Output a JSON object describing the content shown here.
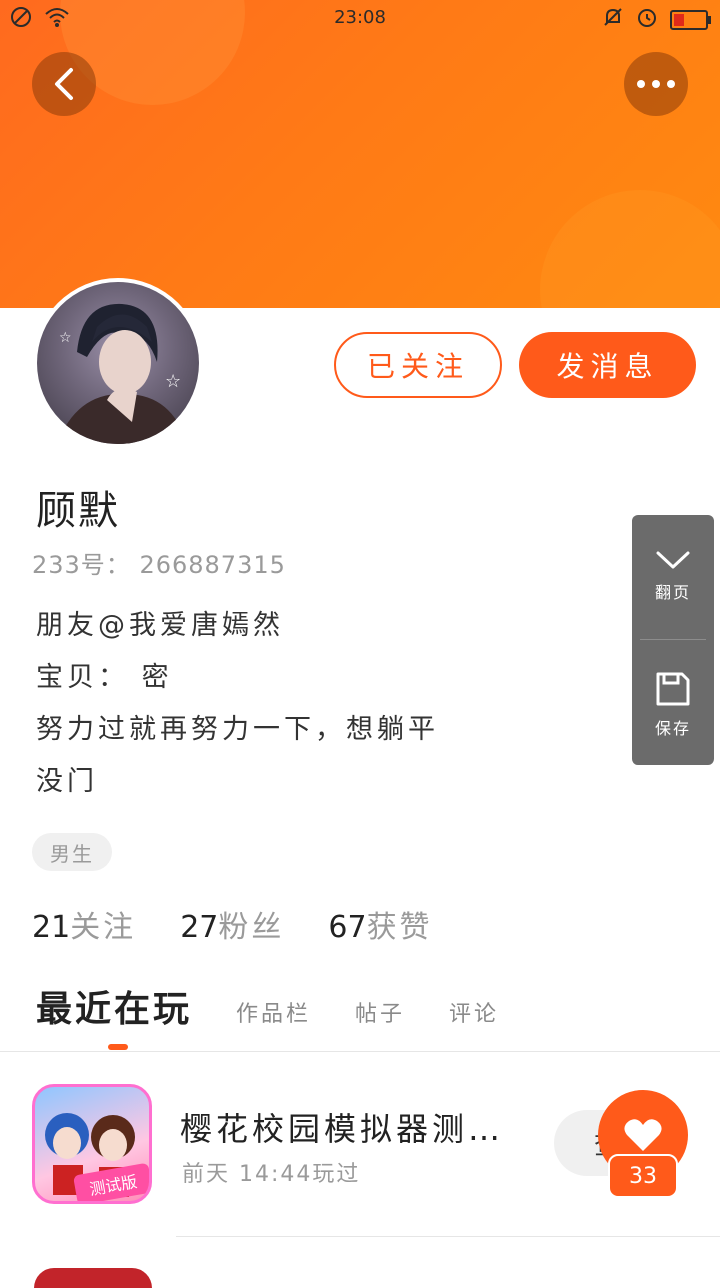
{
  "status_bar": {
    "time": "23:08"
  },
  "profile": {
    "name": "顾默",
    "uid_label": "233号：",
    "uid": "266887315",
    "bio_lines": [
      "朋友@我爱唐嫣然",
      "宝贝：  密",
      "努力过就再努力一下，想躺平",
      "没门"
    ],
    "gender_tag": "男生"
  },
  "actions": {
    "follow_label": "已关注",
    "message_label": "发消息"
  },
  "stats": [
    {
      "num": "21",
      "label": "关注"
    },
    {
      "num": "27",
      "label": "粉丝"
    },
    {
      "num": "67",
      "label": "获赞"
    }
  ],
  "tabs": [
    {
      "label": "最近在玩",
      "active": true
    },
    {
      "label": "作品栏",
      "active": false
    },
    {
      "label": "帖子",
      "active": false
    },
    {
      "label": "评论",
      "active": false
    }
  ],
  "recent_games": [
    {
      "title": "樱花校园模拟器测…",
      "meta": "前天 14:44玩过",
      "button": "查",
      "icon_badge": "测试版"
    }
  ],
  "like_fab": {
    "count": "33"
  },
  "side_panel": {
    "page_label": "翻页",
    "save_label": "保存"
  },
  "colors": {
    "accent": "#ff5a1a",
    "banner": "#ff7a16"
  }
}
